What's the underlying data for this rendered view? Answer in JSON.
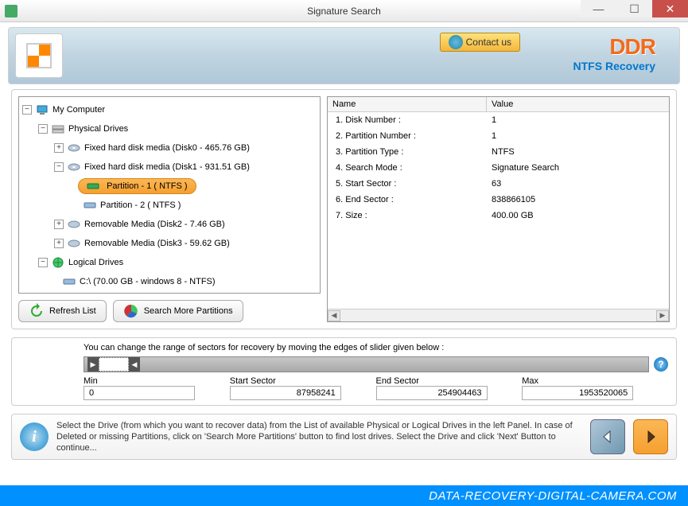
{
  "window": {
    "title": "Signature Search"
  },
  "header": {
    "contact_label": "Contact us",
    "brand": "DDR",
    "brand_sub": "NTFS Recovery"
  },
  "tree": {
    "root": "My Computer",
    "physical": "Physical Drives",
    "disk0": "Fixed hard disk media (Disk0 - 465.76 GB)",
    "disk1": "Fixed hard disk media (Disk1 - 931.51 GB)",
    "part1": "Partition - 1 ( NTFS )",
    "part2": "Partition - 2 ( NTFS )",
    "disk2": "Removable Media (Disk2 - 7.46 GB)",
    "disk3": "Removable Media (Disk3 - 59.62 GB)",
    "logical": "Logical Drives",
    "drive_c": "C:\\ (70.00 GB - windows 8 - NTFS)"
  },
  "tree_buttons": {
    "refresh": "Refresh List",
    "search_more": "Search More Partitions"
  },
  "details": {
    "col_name": "Name",
    "col_value": "Value",
    "rows": [
      {
        "name": "1. Disk Number :",
        "value": "1"
      },
      {
        "name": "2. Partition Number :",
        "value": "1"
      },
      {
        "name": "3. Partition Type :",
        "value": "NTFS"
      },
      {
        "name": "4. Search Mode :",
        "value": "Signature Search"
      },
      {
        "name": "5. Start Sector :",
        "value": "63"
      },
      {
        "name": "6. End Sector :",
        "value": "838866105"
      },
      {
        "name": "7. Size :",
        "value": "400.00 GB"
      }
    ]
  },
  "slider": {
    "instruction": "You can change the range of sectors for recovery by moving the edges of slider given below :",
    "min_label": "Min",
    "start_label": "Start Sector",
    "end_label": "End Sector",
    "max_label": "Max",
    "min_value": "0",
    "start_value": "87958241",
    "end_value": "254904463",
    "max_value": "1953520065"
  },
  "footer": {
    "text": "Select the Drive (from which you want to recover data) from the List of available Physical or Logical Drives in the left Panel. In case of Deleted or missing Partitions, click on 'Search More Partitions' button to find lost drives. Select the Drive and click 'Next' Button to continue..."
  },
  "watermark": "DATA-RECOVERY-DIGITAL-CAMERA.COM"
}
